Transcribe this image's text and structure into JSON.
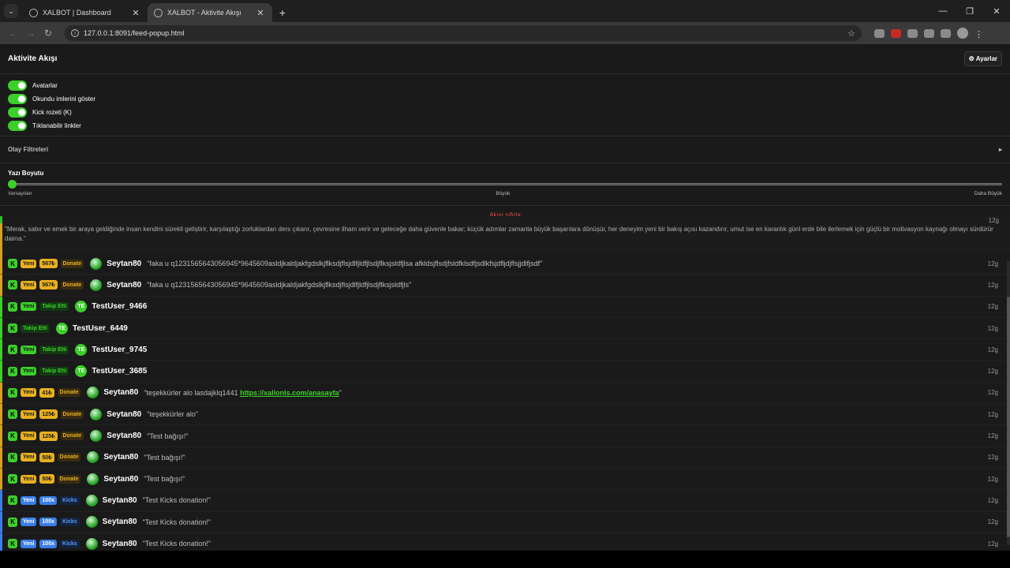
{
  "browser": {
    "tabs": [
      {
        "title": "XALBOT | Dashboard",
        "active": false
      },
      {
        "title": "XALBOT - Aktivite Akışı",
        "active": true
      }
    ],
    "url": "127.0.0.1:8091/feed-popup.html"
  },
  "header": {
    "title": "Aktivite Akışı",
    "settings_label": "⚙ Ayarlar"
  },
  "toggles": [
    {
      "label": "Avatarlar",
      "on": true
    },
    {
      "label": "Okundu imlerini göster",
      "on": true
    },
    {
      "label": "Kick rozeti (K)",
      "on": true
    },
    {
      "label": "Tıklanabilir linkler",
      "on": true
    }
  ],
  "filters": {
    "label": "Olay Filtreleri",
    "arrow": "▸"
  },
  "font_size": {
    "label": "Yazı Boyutu",
    "value_fraction": 0,
    "marks": [
      "Varsayılan",
      "Büyük",
      "Daha Büyük"
    ]
  },
  "reset_label": "Akışı sıfırla",
  "partial_row": {
    "user": "Seytan80",
    "badge": "Donate"
  },
  "long_message": {
    "text": "\"Merak, sabır ve emek bir araya geldiğinde insan kendini sürekli geliştirir, karşılaştığı zorluklardan ders çıkarır, çevresine ilham verir ve geleceğe daha güvenle bakar; küçük adımlar zamanla büyük başarılara dönüşür, her deneyim yeni bir bakış açısı kazandırır, umut ise en karanlık günl erde bile ilerlemek için güçlü bir motivasyon kaynağı olmayı sürdürür daima.\"",
    "time": "12g"
  },
  "feed": [
    {
      "type": "gold",
      "new": "Yeni",
      "amount": "567₺",
      "kind": "Donate",
      "user": "Seytan80",
      "avatar": "sey",
      "msg": "\"faka u q1231565643056945*9645609asldjkaldjakfgdslkjflksdjflsjdlfjldfjlsdjflksjsldfjlsa afkldsjflsdjfsldfklsdfjsdlkfsjdfljdjflsjjdlfjsdf\"",
      "time": "12g"
    },
    {
      "type": "gold",
      "new": "Yeni",
      "amount": "567₺",
      "kind": "Donate",
      "user": "Seytan80",
      "avatar": "sey",
      "msg": "\"faka u q1231565643056945*9645609asldjkaldjakfgdslkjflksdjflsjdlfjldfjlsdjflksjsldfjls\"",
      "time": "12g"
    },
    {
      "type": "green",
      "new": "Yeni",
      "kind": "Takip Etti",
      "user": "TestUser_9466",
      "avatar": "te",
      "msg": "",
      "time": "12g"
    },
    {
      "type": "green",
      "new": "",
      "kind": "Takip Etti",
      "user": "TestUser_6449",
      "avatar": "te",
      "msg": "",
      "time": "12g"
    },
    {
      "type": "green",
      "new": "Yeni",
      "kind": "Takip Etti",
      "user": "TestUser_9745",
      "avatar": "te",
      "msg": "",
      "time": "12g"
    },
    {
      "type": "green",
      "new": "Yeni",
      "kind": "Takip Etti",
      "user": "TestUser_3685",
      "avatar": "te",
      "msg": "",
      "time": "12g"
    },
    {
      "type": "gold",
      "new": "Yeni",
      "amount": "41₺",
      "kind": "Donate",
      "user": "Seytan80",
      "avatar": "sey",
      "msg": "\"teşekkürler alo lasdajklq1441 ",
      "link": "https://xallonls.com/anasayfa",
      "msg_end": "\"",
      "time": "12g"
    },
    {
      "type": "gold",
      "new": "Yeni",
      "amount": "125₺",
      "kind": "Donate",
      "user": "Seytan80",
      "avatar": "sey",
      "msg": "\"teşekkürler alo\"",
      "time": "12g"
    },
    {
      "type": "gold",
      "new": "Yeni",
      "amount": "125₺",
      "kind": "Donate",
      "user": "Seytan80",
      "avatar": "sey",
      "msg": "\"Test bağışı!\"",
      "time": "12g"
    },
    {
      "type": "gold",
      "new": "Yeni",
      "amount": "50₺",
      "kind": "Donate",
      "user": "Seytan80",
      "avatar": "sey",
      "msg": "\"Test bağışı!\"",
      "time": "12g"
    },
    {
      "type": "gold",
      "new": "Yeni",
      "amount": "50₺",
      "kind": "Donate",
      "user": "Seytan80",
      "avatar": "sey",
      "msg": "\"Test bağışı!\"",
      "time": "12g"
    },
    {
      "type": "blue",
      "new": "Yeni",
      "amount": "100x",
      "kind": "Kicks",
      "user": "Seytan80",
      "avatar": "sey",
      "msg": "\"Test Kicks donation!\"",
      "time": "12g"
    },
    {
      "type": "blue",
      "new": "Yeni",
      "amount": "100x",
      "kind": "Kicks",
      "user": "Seytan80",
      "avatar": "sey",
      "msg": "\"Test Kicks donation!\"",
      "time": "12g"
    },
    {
      "type": "blue",
      "new": "Yeni",
      "amount": "100x",
      "kind": "Kicks",
      "user": "Seytan80",
      "avatar": "sey",
      "msg": "\"Test Kicks donation!\"",
      "time": "12g"
    }
  ],
  "kick_badge": "K",
  "avatar_initials_te": "TE",
  "colors": {
    "accent": "#3ccf2b",
    "gold": "#e8b020",
    "blue": "#3a7ee8",
    "reset": "#e04848"
  },
  "icons": [
    "tab-list-icon",
    "globe-icon",
    "close-icon",
    "plus-icon",
    "back-icon",
    "forward-icon",
    "reload-icon",
    "info-icon",
    "star-icon",
    "gear-icon",
    "chevron-right-icon"
  ]
}
